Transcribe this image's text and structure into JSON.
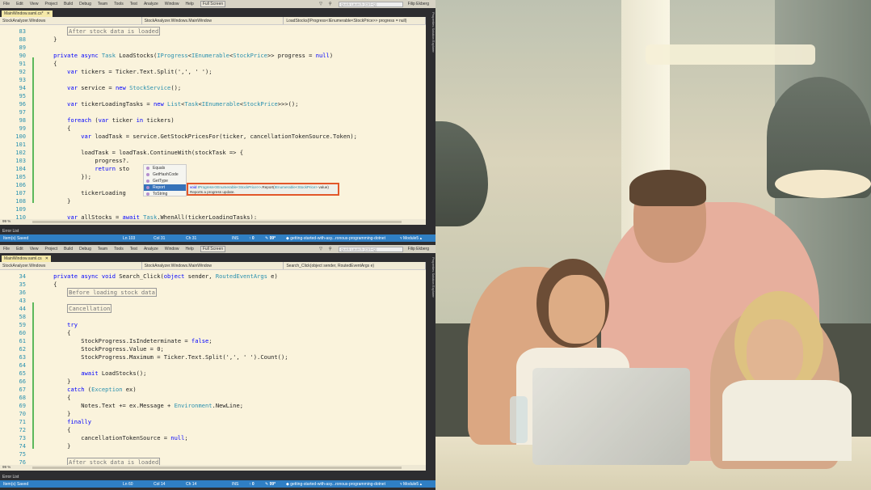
{
  "menu": [
    "File",
    "Edit",
    "View",
    "Project",
    "Build",
    "Debug",
    "Team",
    "Tools",
    "Test",
    "Analyze",
    "Window",
    "Help"
  ],
  "fullscreen": "Full Screen",
  "quick_launch": "Quick Launch (Ctrl+Q)",
  "user": "Filip Ekberg",
  "side_tabs": "Properties  Solution Explorer",
  "error_list": "Error List",
  "zoom": "99 %",
  "colors": {
    "status_bar": "#2f7fc4",
    "editor_bg": "#faf3dc",
    "highlight": "#e2572a"
  },
  "top": {
    "tab": "MainWindow.xaml.cs*",
    "nav": [
      "StockAnalyzer.Windows",
      "StockAnalyzer.Windows.MainWindow",
      "LoadStocks(IProgress<IEnumerable<StockPrice>> progress = null)"
    ],
    "lines": [
      {
        "n": "83",
        "i": 2,
        "s": [
          [
            "After stock data is loaded",
            "c"
          ]
        ]
      },
      {
        "n": "88",
        "i": 1,
        "s": [
          [
            "}",
            ""
          ]
        ]
      },
      {
        "n": "89",
        "i": 0,
        "s": []
      },
      {
        "n": "90",
        "i": 1,
        "s": [
          [
            "private async ",
            "k"
          ],
          [
            "Task",
            "t"
          ],
          [
            " LoadStocks(",
            ""
          ],
          [
            "IProgress",
            "t"
          ],
          [
            "<",
            ""
          ],
          [
            "IEnumerable",
            "t"
          ],
          [
            "<",
            ""
          ],
          [
            "StockPrice",
            "t"
          ],
          [
            ">> progress = ",
            ""
          ],
          [
            "null",
            "k"
          ],
          [
            ")",
            ""
          ]
        ]
      },
      {
        "n": "91",
        "i": 1,
        "s": [
          [
            "{",
            ""
          ]
        ]
      },
      {
        "n": "92",
        "i": 2,
        "s": [
          [
            "var",
            "k"
          ],
          [
            " tickers = Ticker.Text.Split(',', ' ');",
            ""
          ]
        ]
      },
      {
        "n": "93",
        "i": 0,
        "s": []
      },
      {
        "n": "94",
        "i": 2,
        "s": [
          [
            "var",
            "k"
          ],
          [
            " service = ",
            ""
          ],
          [
            "new ",
            "k"
          ],
          [
            "StockService",
            "t"
          ],
          [
            "();",
            ""
          ]
        ]
      },
      {
        "n": "95",
        "i": 0,
        "s": []
      },
      {
        "n": "96",
        "i": 2,
        "s": [
          [
            "var",
            "k"
          ],
          [
            " tickerLoadingTasks = ",
            ""
          ],
          [
            "new ",
            "k"
          ],
          [
            "List",
            "t"
          ],
          [
            "<",
            ""
          ],
          [
            "Task",
            "t"
          ],
          [
            "<",
            ""
          ],
          [
            "IEnumerable",
            "t"
          ],
          [
            "<",
            ""
          ],
          [
            "StockPrice",
            "t"
          ],
          [
            ">>>();",
            ""
          ]
        ]
      },
      {
        "n": "97",
        "i": 0,
        "s": []
      },
      {
        "n": "98",
        "i": 2,
        "s": [
          [
            "foreach",
            "k"
          ],
          [
            " (",
            ""
          ],
          [
            "var",
            "k"
          ],
          [
            " ticker ",
            ""
          ],
          [
            "in",
            "k"
          ],
          [
            " tickers)",
            ""
          ]
        ]
      },
      {
        "n": "99",
        "i": 2,
        "s": [
          [
            "{",
            ""
          ]
        ]
      },
      {
        "n": "100",
        "i": 3,
        "s": [
          [
            "var",
            "k"
          ],
          [
            " loadTask = service.GetStockPricesFor(ticker, cancellationTokenSource.Token);",
            ""
          ]
        ]
      },
      {
        "n": "101",
        "i": 0,
        "s": []
      },
      {
        "n": "102",
        "i": 3,
        "s": [
          [
            "loadTask = loadTask.ContinueWith(stockTask => {",
            ""
          ]
        ]
      },
      {
        "n": "103",
        "i": 4,
        "s": [
          [
            "progress?.",
            ""
          ]
        ]
      },
      {
        "n": "104",
        "i": 4,
        "s": [
          [
            "return",
            "k"
          ],
          [
            " sto            t;",
            ""
          ]
        ]
      },
      {
        "n": "105",
        "i": 3,
        "s": [
          [
            "});",
            ""
          ]
        ]
      },
      {
        "n": "106",
        "i": 0,
        "s": []
      },
      {
        "n": "107",
        "i": 3,
        "s": [
          [
            "tickerLoading",
            ""
          ]
        ]
      },
      {
        "n": "108",
        "i": 2,
        "s": [
          [
            "}",
            ""
          ]
        ]
      },
      {
        "n": "109",
        "i": 0,
        "s": []
      },
      {
        "n": "110",
        "i": 2,
        "s": [
          [
            "var",
            "k"
          ],
          [
            " allStocks = ",
            ""
          ],
          [
            "await ",
            "k"
          ],
          [
            "Task",
            "t"
          ],
          [
            ".WhenAll(tickerLoadingTasks);",
            ""
          ]
        ]
      }
    ],
    "completion": [
      "Equals",
      "GetHashCode",
      "GetType",
      "Report",
      "ToString"
    ],
    "tooltip": {
      "sig_a": "void ",
      "sig_b": "IProgress<IEnumerable<StockPrice>>",
      "sig_c": ".Report(",
      "sig_d": "IEnumerable<StockPrice>",
      "sig_e": " value)",
      "desc": "Reports a progress update."
    },
    "status": {
      "msg": "Item(s) Saved",
      "ln": "Ln 103",
      "col": "Col 31",
      "ch": "Ch 31",
      "ins": "INS",
      "up": "0",
      "pen": "99*",
      "repo": "getting-started-with-asy...ronous-programming-dotnet",
      "branch": "Module5"
    }
  },
  "bottom": {
    "tab": "MainWindow.xaml.cs",
    "nav": [
      "StockAnalyzer.Windows",
      "StockAnalyzer.Windows.MainWindow",
      "Search_Click(object sender, RoutedEventArgs e)"
    ],
    "lines": [
      {
        "n": "34",
        "i": 1,
        "s": [
          [
            "private async void ",
            "k"
          ],
          [
            "Search_Click(",
            ""
          ],
          [
            "object",
            "k"
          ],
          [
            " sender, ",
            ""
          ],
          [
            "RoutedEventArgs",
            "t"
          ],
          [
            " e)",
            ""
          ]
        ]
      },
      {
        "n": "35",
        "i": 1,
        "s": [
          [
            "{",
            ""
          ]
        ]
      },
      {
        "n": "36",
        "i": 2,
        "s": [
          [
            "Before loading stock data",
            "c"
          ]
        ]
      },
      {
        "n": "43",
        "i": 0,
        "s": []
      },
      {
        "n": "44",
        "i": 2,
        "s": [
          [
            "Cancellation",
            "c"
          ]
        ]
      },
      {
        "n": "58",
        "i": 0,
        "s": []
      },
      {
        "n": "59",
        "i": 2,
        "s": [
          [
            "try",
            "k"
          ]
        ]
      },
      {
        "n": "60",
        "i": 2,
        "s": [
          [
            "{",
            ""
          ]
        ]
      },
      {
        "n": "61",
        "i": 3,
        "s": [
          [
            "StockProgress.IsIndeterminate = ",
            ""
          ],
          [
            "false",
            "k"
          ],
          [
            ";",
            ""
          ]
        ]
      },
      {
        "n": "62",
        "i": 3,
        "s": [
          [
            "StockProgress.Value = 0;",
            ""
          ]
        ]
      },
      {
        "n": "63",
        "i": 3,
        "s": [
          [
            "StockProgress.Maximum = Ticker.Text.Split(',', ' ').Count();",
            ""
          ]
        ]
      },
      {
        "n": "64",
        "i": 0,
        "s": []
      },
      {
        "n": "65",
        "i": 3,
        "s": [
          [
            "await",
            "k"
          ],
          [
            " LoadStocks();",
            ""
          ]
        ]
      },
      {
        "n": "66",
        "i": 2,
        "s": [
          [
            "}",
            ""
          ]
        ]
      },
      {
        "n": "67",
        "i": 2,
        "s": [
          [
            "catch",
            "k"
          ],
          [
            " (",
            ""
          ],
          [
            "Exception",
            "t"
          ],
          [
            " ex)",
            ""
          ]
        ]
      },
      {
        "n": "68",
        "i": 2,
        "s": [
          [
            "{",
            ""
          ]
        ]
      },
      {
        "n": "69",
        "i": 3,
        "s": [
          [
            "Notes.Text += ex.Message + ",
            ""
          ],
          [
            "Environment",
            "t"
          ],
          [
            ".NewLine;",
            ""
          ]
        ]
      },
      {
        "n": "70",
        "i": 2,
        "s": [
          [
            "}",
            ""
          ]
        ]
      },
      {
        "n": "71",
        "i": 2,
        "s": [
          [
            "finally",
            "k"
          ]
        ]
      },
      {
        "n": "72",
        "i": 2,
        "s": [
          [
            "{",
            ""
          ]
        ]
      },
      {
        "n": "73",
        "i": 3,
        "s": [
          [
            "cancellationTokenSource = ",
            ""
          ],
          [
            "null",
            "k"
          ],
          [
            ";",
            ""
          ]
        ]
      },
      {
        "n": "74",
        "i": 2,
        "s": [
          [
            "}",
            ""
          ]
        ]
      },
      {
        "n": "75",
        "i": 0,
        "s": []
      },
      {
        "n": "76",
        "i": 2,
        "s": [
          [
            "After stock data is loaded",
            "c"
          ]
        ]
      }
    ],
    "status": {
      "msg": "Item(s) Saved",
      "ln": "Ln 60",
      "col": "Col 14",
      "ch": "Ch 14",
      "ins": "INS",
      "up": "0",
      "pen": "99*",
      "repo": "getting-started-with-asy...ronous-programming-dotnet",
      "branch": "Module5"
    }
  }
}
